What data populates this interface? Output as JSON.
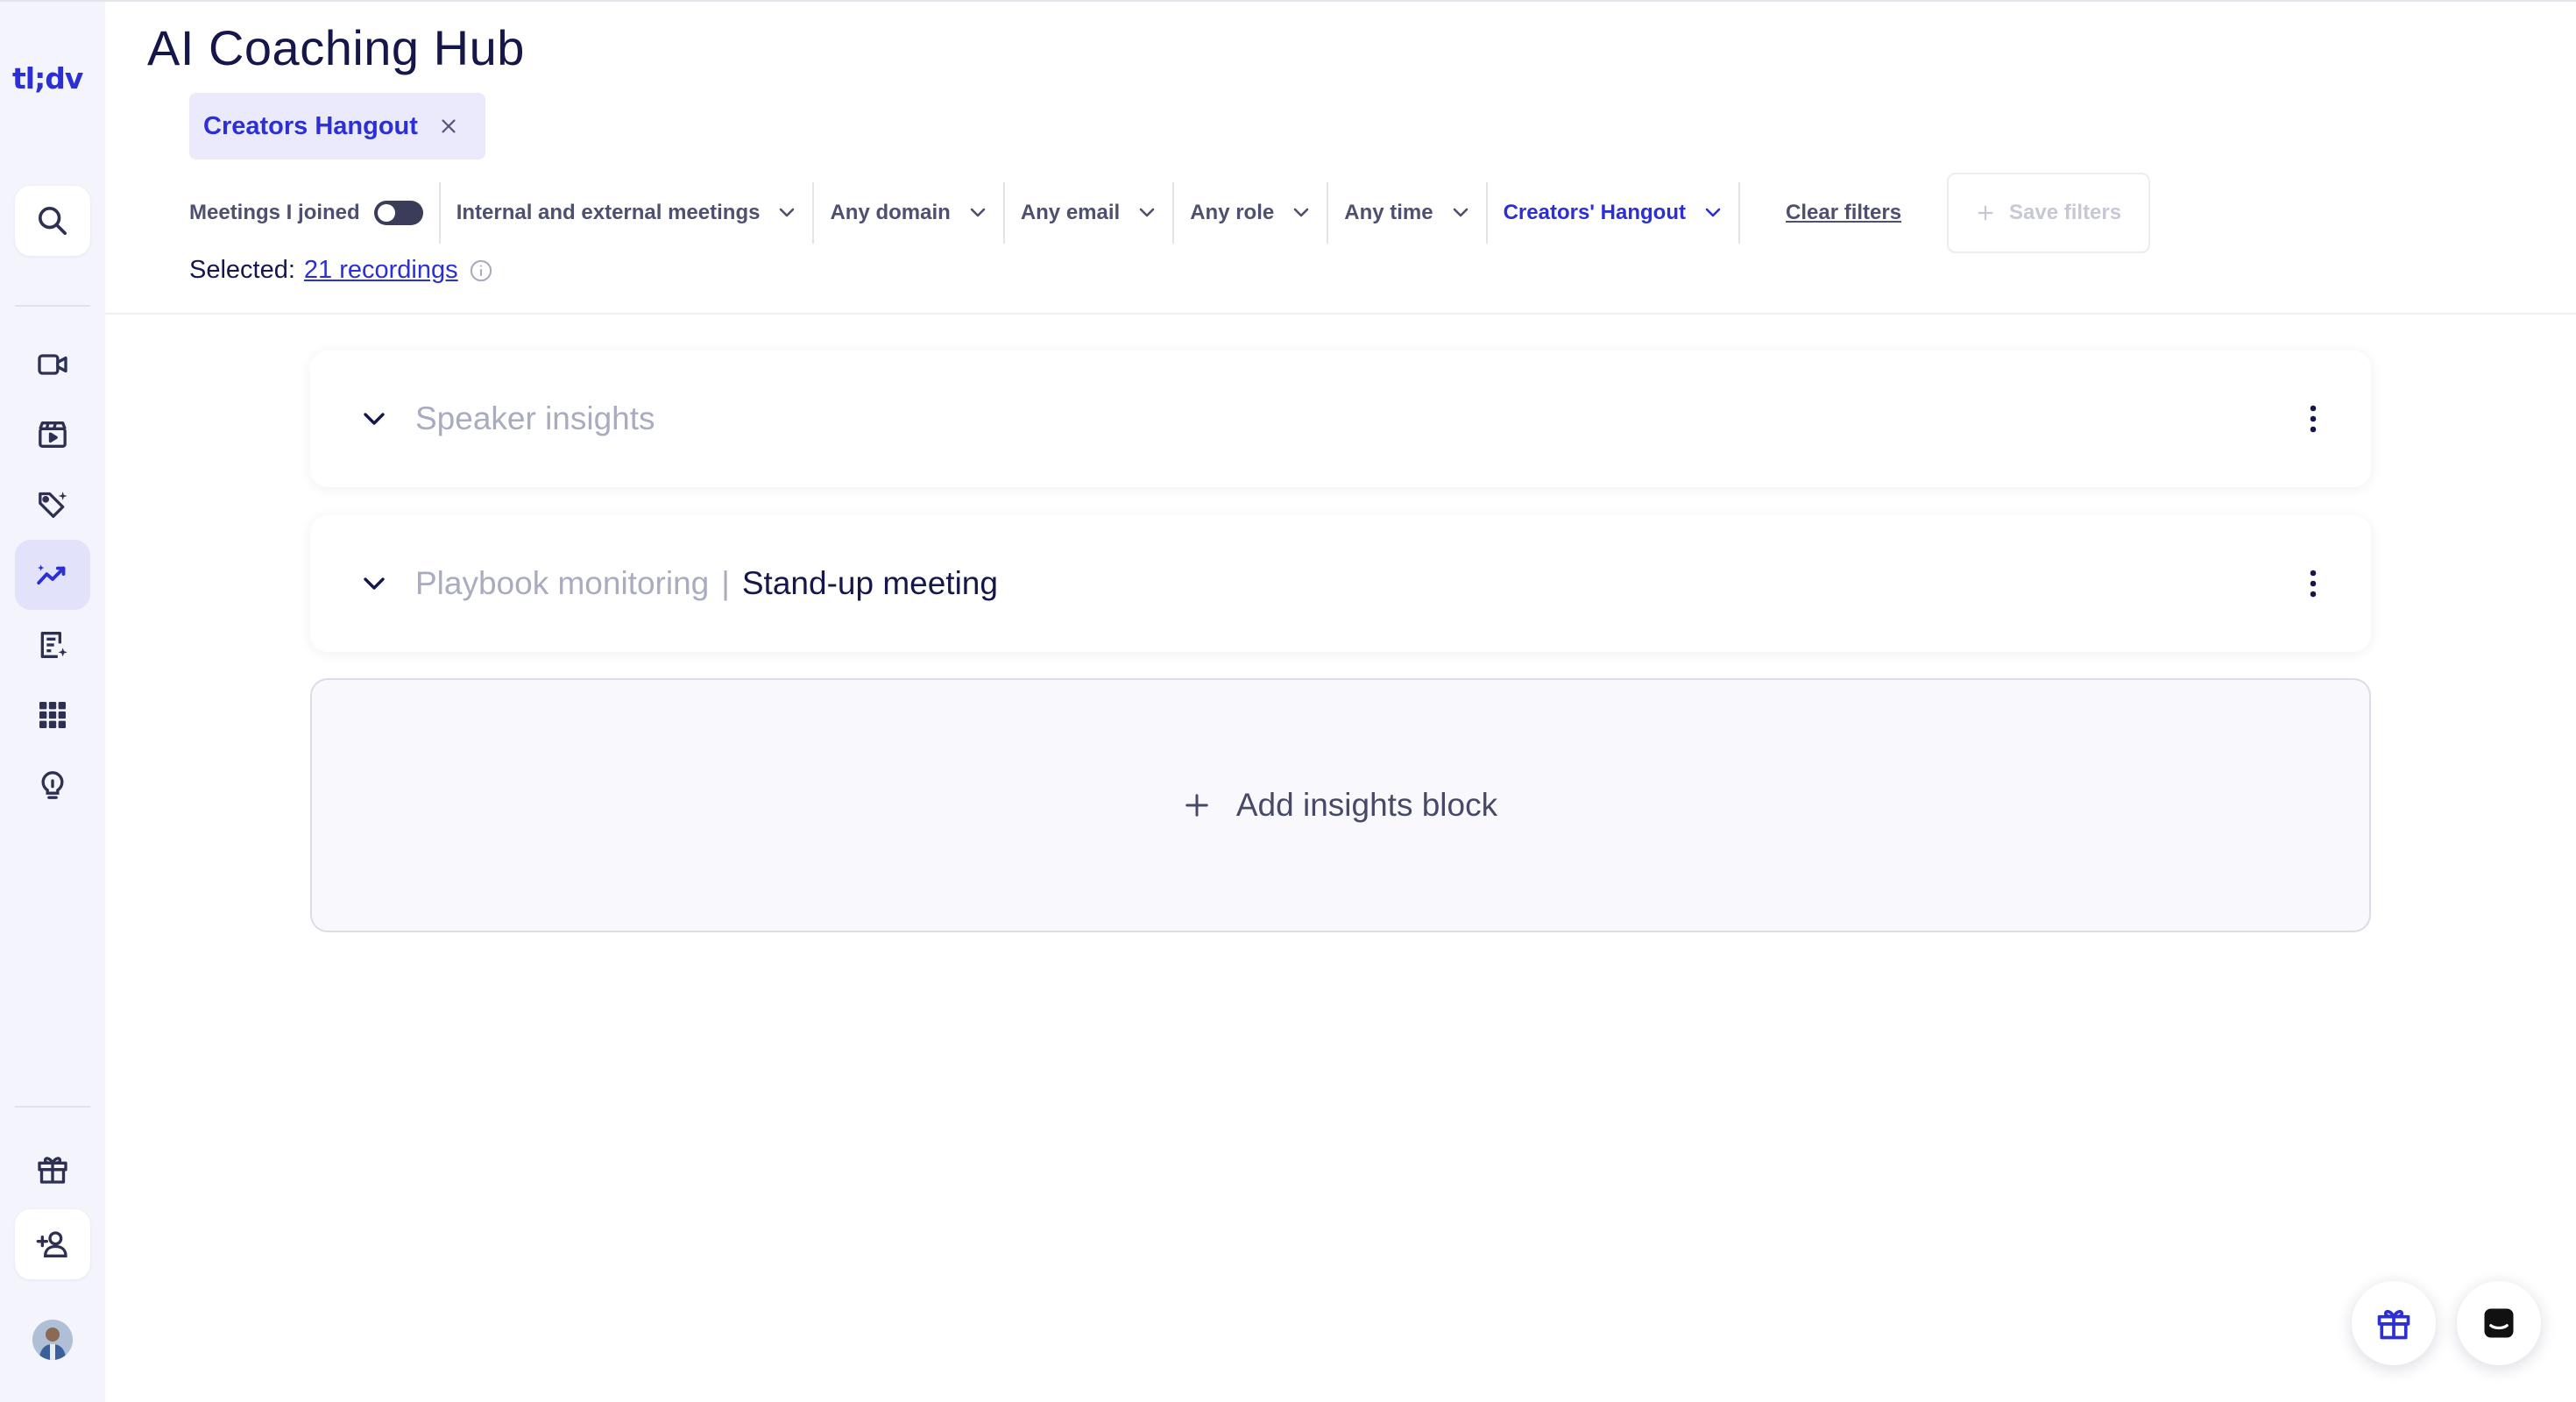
{
  "app": {
    "logo_text": "tl;dv",
    "title": "AI Coaching Hub"
  },
  "sidebar": {
    "items": [
      {
        "name": "search",
        "icon": "search-icon"
      },
      {
        "name": "meetings",
        "icon": "video-camera-icon"
      },
      {
        "name": "clips",
        "icon": "film-clapper-icon"
      },
      {
        "name": "tags",
        "icon": "ai-tag-icon"
      },
      {
        "name": "coaching",
        "icon": "trend-chart-icon",
        "active": true
      },
      {
        "name": "notes",
        "icon": "ai-note-icon"
      },
      {
        "name": "integrations",
        "icon": "apps-grid-icon"
      },
      {
        "name": "ideas",
        "icon": "lightbulb-icon"
      },
      {
        "name": "rewards",
        "icon": "gift-icon"
      },
      {
        "name": "invite",
        "icon": "add-user-icon"
      }
    ]
  },
  "chip": {
    "label": "Creators Hangout"
  },
  "filters": {
    "meetings_joined": "Meetings I joined",
    "meeting_type": "Internal and external meetings",
    "domain": "Any domain",
    "email": "Any email",
    "role": "Any role",
    "time": "Any time",
    "group": "Creators' Hangout",
    "clear": "Clear filters",
    "save": "Save filters"
  },
  "selection": {
    "prefix": "Selected:",
    "link": "21 recordings"
  },
  "cards": [
    {
      "title": "Speaker insights"
    },
    {
      "title": "Playbook monitoring",
      "separator": "|",
      "subtitle": "Stand-up meeting"
    }
  ],
  "add_block": {
    "label": "Add insights block"
  },
  "colors": {
    "accent": "#2b2fd4",
    "sidebar_bg": "#f4f4fc",
    "active_item_bg": "#e2e3fa",
    "title": "#15174a"
  }
}
